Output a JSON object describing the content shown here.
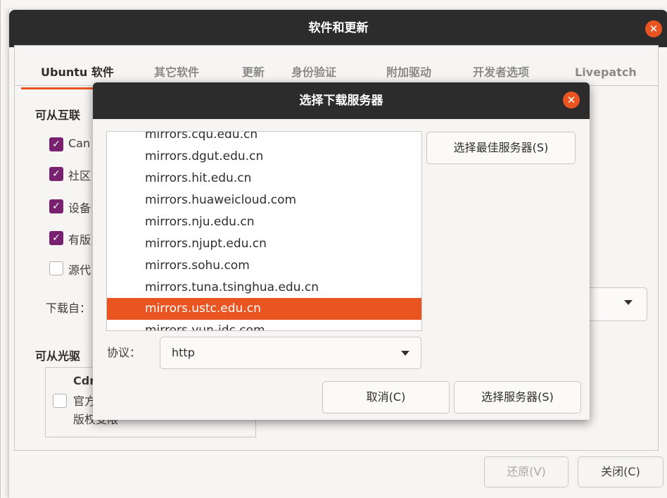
{
  "main_window": {
    "title": "软件和更新",
    "tabs": [
      "Ubuntu 软件",
      "其它软件",
      "更新",
      "身份验证",
      "附加驱动",
      "开发者选项",
      "Livepatch"
    ],
    "section_internet": "可从互联",
    "checkboxes": [
      {
        "label": "Can",
        "checked": true
      },
      {
        "label": "社区",
        "checked": true
      },
      {
        "label": "设备",
        "checked": true
      },
      {
        "label": "有版",
        "checked": true
      },
      {
        "label": "源代",
        "checked": false
      }
    ],
    "download_from_label": "下载自：",
    "section_cdrom": "可从光驱",
    "cdrom": {
      "line1": "Cdr",
      "line2": "官方",
      "line3": "版权受限"
    },
    "revert_button": "还原(V)",
    "close_button": "关闭(C)"
  },
  "dialog": {
    "title": "选择下载服务器",
    "servers": [
      "mirrors.cqu.edu.cn",
      "mirrors.dgut.edu.cn",
      "mirrors.hit.edu.cn",
      "mirrors.huaweicloud.com",
      "mirrors.nju.edu.cn",
      "mirrors.njupt.edu.cn",
      "mirrors.sohu.com",
      "mirrors.tuna.tsinghua.edu.cn",
      "mirrors.ustc.edu.cn",
      "mirrors.yun-idc.com"
    ],
    "selected_server": "mirrors.ustc.edu.cn",
    "best_server_button": "选择最佳服务器(S)",
    "protocol_label": "协议：",
    "protocol_value": "http",
    "cancel_button": "取消(C)",
    "choose_button": "选择服务器(S)"
  },
  "colors": {
    "accent": "#e95420",
    "checkbox": "#77216f",
    "titlebar": "#2c2c2c"
  }
}
